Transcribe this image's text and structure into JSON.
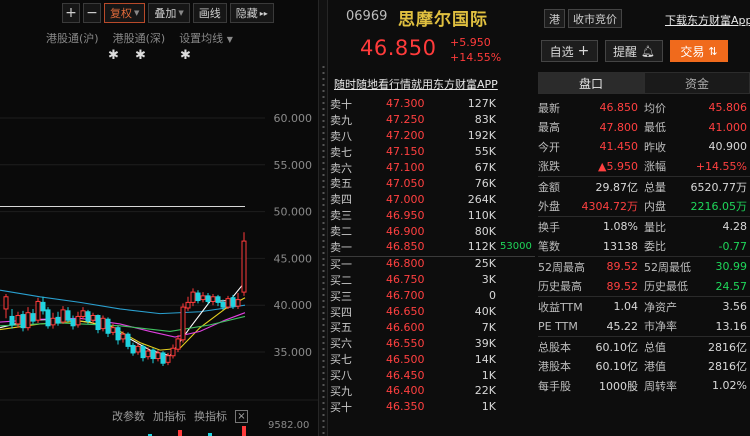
{
  "toolbar": {
    "plus": "+",
    "minus": "−",
    "fuquan": "复权",
    "diejia": "叠加",
    "huaxian": "画线",
    "yincang": "隐藏",
    "more": "▸▸"
  },
  "overlays": [
    "港股通(沪)",
    "港股通(深)",
    "设置均线"
  ],
  "chart": {
    "y_ticks": [
      "60.000",
      "55.000",
      "50.000",
      "45.000",
      "40.000",
      "35.000"
    ],
    "volume_max": "9582.00",
    "colors": {
      "up": "#ff3b3b",
      "down": "#1fd3e0",
      "ma5": "#ffffff",
      "ma10": "#e6d020",
      "ma20": "#e040e0",
      "ma60": "#40c060"
    }
  },
  "bottom_tools": {
    "gaicanshu": "改参数",
    "jiazhibiao": "加指标",
    "huanzhibiao": "换指标",
    "close": "×"
  },
  "stock": {
    "code": "06969",
    "name": "思摩尔国际",
    "price": "46.850",
    "change": "+5.950",
    "change_pct": "+14.55%",
    "tags": [
      "港",
      "收市竞价"
    ],
    "download": "下载东方财富App"
  },
  "actions": {
    "zixuan": "自选",
    "tixing": "提醒",
    "jiaoyi": "交易"
  },
  "promo": "随时随地看行情就用东方财富APP",
  "tabs": [
    "盘口",
    "资金"
  ],
  "asks": [
    {
      "label": "卖十",
      "price": "47.300",
      "vol": "127K"
    },
    {
      "label": "卖九",
      "price": "47.250",
      "vol": "83K"
    },
    {
      "label": "卖八",
      "price": "47.200",
      "vol": "192K"
    },
    {
      "label": "卖七",
      "price": "47.150",
      "vol": "55K"
    },
    {
      "label": "卖六",
      "price": "47.100",
      "vol": "67K"
    },
    {
      "label": "卖五",
      "price": "47.050",
      "vol": "76K"
    },
    {
      "label": "卖四",
      "price": "47.000",
      "vol": "264K"
    },
    {
      "label": "卖三",
      "price": "46.950",
      "vol": "110K"
    },
    {
      "label": "卖二",
      "price": "46.900",
      "vol": "80K"
    },
    {
      "label": "卖一",
      "price": "46.850",
      "vol": "112K",
      "extra": "53000"
    }
  ],
  "bids": [
    {
      "label": "买一",
      "price": "46.800",
      "vol": "25K"
    },
    {
      "label": "买二",
      "price": "46.750",
      "vol": "3K"
    },
    {
      "label": "买三",
      "price": "46.700",
      "vol": "0"
    },
    {
      "label": "买四",
      "price": "46.650",
      "vol": "40K"
    },
    {
      "label": "买五",
      "price": "46.600",
      "vol": "7K"
    },
    {
      "label": "买六",
      "price": "46.550",
      "vol": "39K"
    },
    {
      "label": "买七",
      "price": "46.500",
      "vol": "14K"
    },
    {
      "label": "买八",
      "price": "46.450",
      "vol": "1K"
    },
    {
      "label": "买九",
      "price": "46.400",
      "vol": "22K"
    },
    {
      "label": "买十",
      "price": "46.350",
      "vol": "1K"
    }
  ],
  "stats": [
    {
      "l1": "最新",
      "v1": "46.850",
      "c1": "red",
      "l2": "均价",
      "v2": "45.806",
      "c2": "red"
    },
    {
      "l1": "最高",
      "v1": "47.800",
      "c1": "red",
      "l2": "最低",
      "v2": "41.000",
      "c2": "red"
    },
    {
      "l1": "今开",
      "v1": "41.450",
      "c1": "red",
      "l2": "昨收",
      "v2": "40.900",
      "c2": ""
    },
    {
      "l1": "涨跌",
      "v1": "▲5.950",
      "c1": "red",
      "l2": "涨幅",
      "v2": "+14.55%",
      "c2": "red"
    },
    {
      "l1": "金额",
      "v1": "29.87亿",
      "c1": "",
      "l2": "总量",
      "v2": "6520.77万",
      "c2": ""
    },
    {
      "l1": "外盘",
      "v1": "4304.72万",
      "c1": "red",
      "l2": "内盘",
      "v2": "2216.05万",
      "c2": "green"
    },
    {
      "l1": "换手",
      "v1": "1.08%",
      "c1": "",
      "l2": "量比",
      "v2": "4.28",
      "c2": ""
    },
    {
      "l1": "笔数",
      "v1": "13138",
      "c1": "",
      "l2": "委比",
      "v2": "-0.77",
      "c2": "green"
    },
    {
      "l1": "52周最高",
      "v1": "89.52",
      "c1": "red",
      "l2": "52周最低",
      "v2": "30.99",
      "c2": "green"
    },
    {
      "l1": "历史最高",
      "v1": "89.52",
      "c1": "red",
      "l2": "历史最低",
      "v2": "24.57",
      "c2": "green"
    },
    {
      "l1": "收益TTM",
      "v1": "1.04",
      "c1": "",
      "l2": "净资产",
      "v2": "3.56",
      "c2": ""
    },
    {
      "l1": "PE TTM",
      "v1": "45.22",
      "c1": "",
      "l2": "市净率",
      "v2": "13.16",
      "c2": ""
    },
    {
      "l1": "总股本",
      "v1": "60.10亿",
      "c1": "",
      "l2": "总值",
      "v2": "2816亿",
      "c2": ""
    },
    {
      "l1": "港股本",
      "v1": "60.10亿",
      "c1": "",
      "l2": "港值",
      "v2": "2816亿",
      "c2": ""
    },
    {
      "l1": "每手股",
      "v1": "1000股",
      "c1": "",
      "l2": "周转率",
      "v2": "1.02%",
      "c2": ""
    }
  ]
}
